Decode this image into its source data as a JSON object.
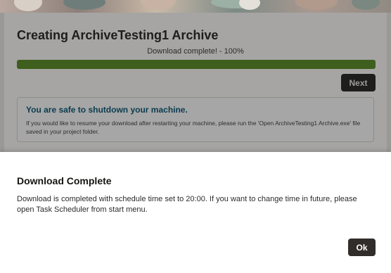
{
  "progress": {
    "title": "Creating ArchiveTesting1 Archive",
    "status_text": "Download complete! - 100%",
    "percent": 100,
    "bar_color": "#3e5f1d",
    "next_label": "Next"
  },
  "notice": {
    "title": "You are safe to shutdown your machine.",
    "body": "If you would like to resume your download after restarting your machine, please run the 'Open ArchiveTesting1 Archive.exe' file saved in your project folder."
  },
  "dialog": {
    "title": "Download Complete",
    "body": "Download is completed with schedule time set to 20:00. If you want to change time in future, please open Task Scheduler from start menu.",
    "ok_label": "Ok"
  },
  "colors": {
    "overlay": "#9a9996",
    "dialog_bg": "#ffffff",
    "primary_button": "#312d2a",
    "notice_title": "#0c3b50"
  }
}
